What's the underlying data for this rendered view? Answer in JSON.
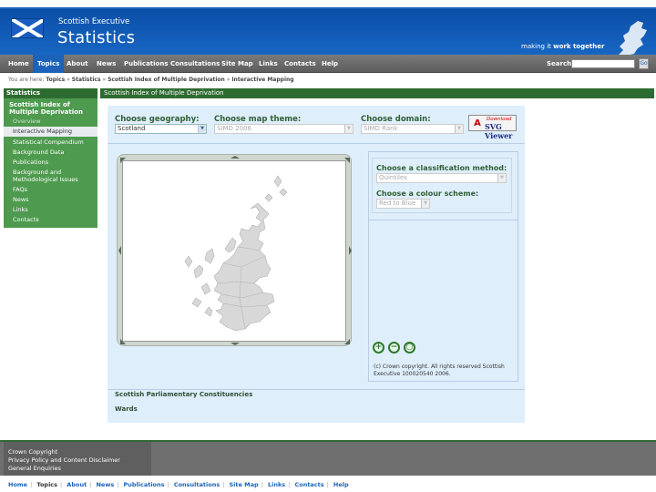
{
  "header": {
    "org": "Scottish Executive",
    "title": "Statistics",
    "tagline_prefix": "making it ",
    "tagline_bold": "work together"
  },
  "nav": {
    "items": [
      "Home",
      "Topics",
      "About",
      "News",
      "Publications",
      "Consultations",
      "Site Map",
      "Links",
      "Contacts",
      "Help"
    ],
    "active": "Topics",
    "search_label": "Search:",
    "search_value": "",
    "search_button": "Go"
  },
  "breadcrumb": {
    "prefix": "You are here:",
    "trail": [
      "Topics",
      "Statistics",
      "Scottish Index of Multiple Deprivation",
      "Interactive Mapping"
    ],
    "separator": "»"
  },
  "sidebar": {
    "title": "Statistics",
    "heading": "Scottish Index of Multiple Deprivation",
    "items": [
      "Overview",
      "Interactive Mapping",
      "Statistical Compendium",
      "Background Data",
      "Publications",
      "Background and Methodological Issues",
      "FAQs",
      "News",
      "Links",
      "Contacts"
    ],
    "active": "Interactive Mapping"
  },
  "main": {
    "title": "Scottish Index of Multiple Deprivation",
    "geography": {
      "label": "Choose geography:",
      "value": "Scotland"
    },
    "theme": {
      "label": "Choose map theme:",
      "value": "SIMD 2006"
    },
    "domain": {
      "label": "Choose domain:",
      "value": "SIMD Rank"
    },
    "adobe": {
      "line1": "Download",
      "line2": "SVG Viewer",
      "logo": "A"
    },
    "classification": {
      "label": "Choose a classification method:",
      "value": "Quintiles"
    },
    "colour": {
      "label": "Choose a colour scheme:",
      "value": "Red to Blue"
    },
    "zoom": {
      "in": "+",
      "out": "−",
      "reset": "○"
    },
    "copyright": "(c) Crown copyright. All rights reserved Scottish Executive 100020540 2006.",
    "links": [
      "Scottish Parliamentary Constituencies",
      "Wards"
    ]
  },
  "footer": {
    "items": [
      "Crown Copyright",
      "Privacy Policy and Content Disclaimer",
      "General Enquiries"
    ],
    "nav": [
      "Home",
      "Topics",
      "About",
      "News",
      "Publications",
      "Consultations",
      "Site Map",
      "Links",
      "Contacts",
      "Help"
    ],
    "nav_current": "Topics"
  },
  "colors": {
    "header_blue": "#1766c2",
    "nav_grey": "#6a6a6a",
    "sidebar_green": "#4e9a4e",
    "panel_blue": "#dfeefb"
  }
}
